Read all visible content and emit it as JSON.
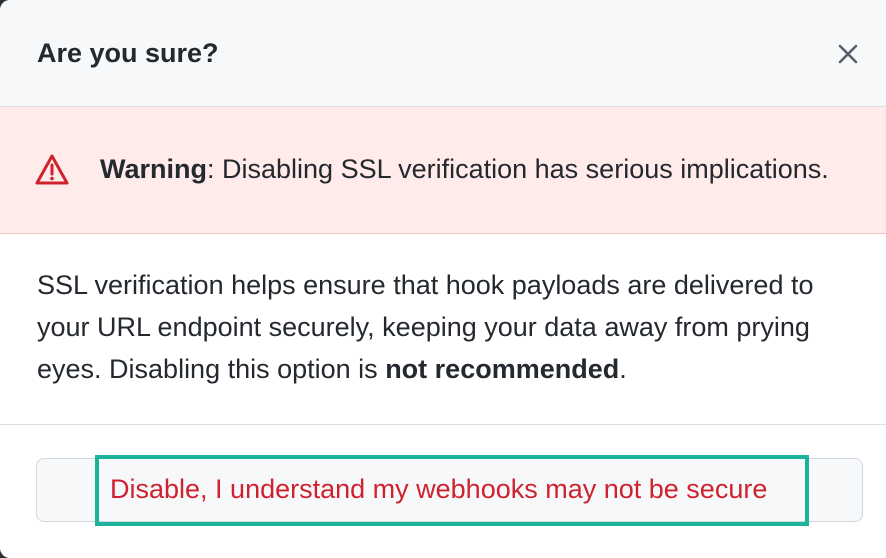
{
  "dialog": {
    "title": "Are you sure?",
    "close_icon": "close-icon",
    "warning": {
      "icon": "alert-icon",
      "label": "Warning",
      "message": ": Disabling SSL verification has serious implications."
    },
    "body": {
      "text_before": "SSL verification helps ensure that hook payloads are delivered to your URL endpoint securely, keeping your data away from prying eyes. Disabling this option is ",
      "emphasis": "not recommended",
      "text_after": "."
    },
    "confirm_button": {
      "label": "Disable, I understand my webhooks may not be secure"
    }
  },
  "colors": {
    "danger": "#cf222e",
    "warning_bg": "#ffebe9",
    "highlight": "#1bb39a"
  }
}
